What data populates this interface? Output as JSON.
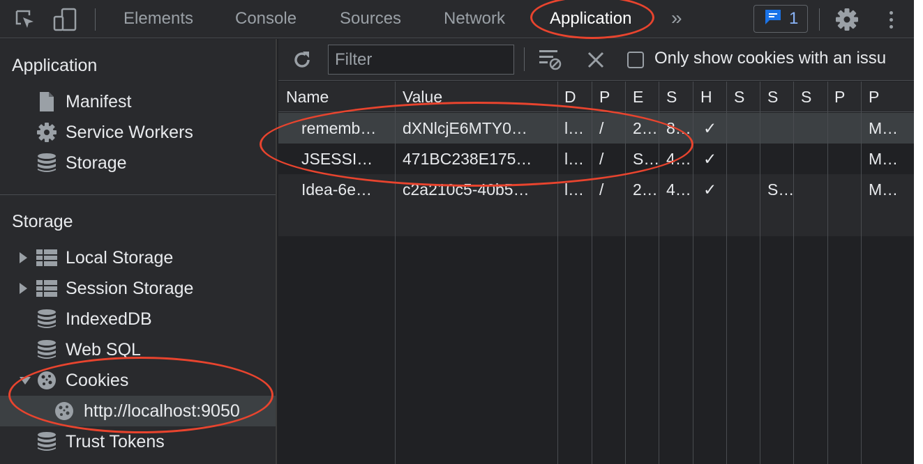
{
  "tabbar": {
    "tabs": [
      "Elements",
      "Console",
      "Sources",
      "Network",
      "Application"
    ],
    "active_tab": "Application",
    "more_tabs_icon": "»",
    "issues_count": "1",
    "icons": [
      "inspect-element-icon",
      "device-toolbar-icon",
      "issues-message-icon",
      "settings-gear-icon",
      "more-options-icon"
    ]
  },
  "sidebar": {
    "application_header": "Application",
    "application_items": [
      {
        "label": "Manifest",
        "icon": "document-icon"
      },
      {
        "label": "Service Workers",
        "icon": "gear-icon"
      },
      {
        "label": "Storage",
        "icon": "database-icon"
      }
    ],
    "storage_header": "Storage",
    "storage_items": [
      {
        "label": "Local Storage",
        "icon": "table-grid-icon",
        "expand": "collapsed"
      },
      {
        "label": "Session Storage",
        "icon": "table-grid-icon",
        "expand": "collapsed"
      },
      {
        "label": "IndexedDB",
        "icon": "database-icon"
      },
      {
        "label": "Web SQL",
        "icon": "database-icon"
      },
      {
        "label": "Cookies",
        "icon": "cookie-icon",
        "expand": "expanded"
      },
      {
        "label": "http://localhost:9050",
        "icon": "cookie-icon",
        "selected": true
      },
      {
        "label": "Trust Tokens",
        "icon": "database-icon"
      }
    ]
  },
  "toolbar": {
    "filter_placeholder": "Filter",
    "checkbox_label": "Only show cookies with an issu",
    "checkbox_checked": false,
    "icons": [
      "refresh-icon",
      "clear-filtered-icon",
      "close-icon"
    ]
  },
  "cookies_table": {
    "columns": [
      "Name",
      "Value",
      "D",
      "P",
      "E",
      "S",
      "H",
      "S",
      "S",
      "S",
      "P",
      "P"
    ],
    "rows": [
      [
        "rememb…",
        "dXNlcjE6MTY0…",
        "l…",
        "/",
        "2…",
        "8…",
        "✓",
        "",
        "",
        "",
        "",
        "M…"
      ],
      [
        "JSESSI…",
        "471BC238E175…",
        "l…",
        "/",
        "S…",
        "4…",
        "✓",
        "",
        "",
        "",
        "",
        "M…"
      ],
      [
        "Idea-6e…",
        "c2a210c5-40b5…",
        "l…",
        "/",
        "2…",
        "4…",
        "✓",
        "",
        "S…",
        "",
        "",
        "M…"
      ]
    ],
    "selected_row": 0
  },
  "colors": {
    "highlight_circle": "#e8442e",
    "panel_bg": "#202124",
    "sidebar_bg": "#292a2d",
    "selected_bg": "#3c4043",
    "issues_blue": "#8ab4f8"
  }
}
